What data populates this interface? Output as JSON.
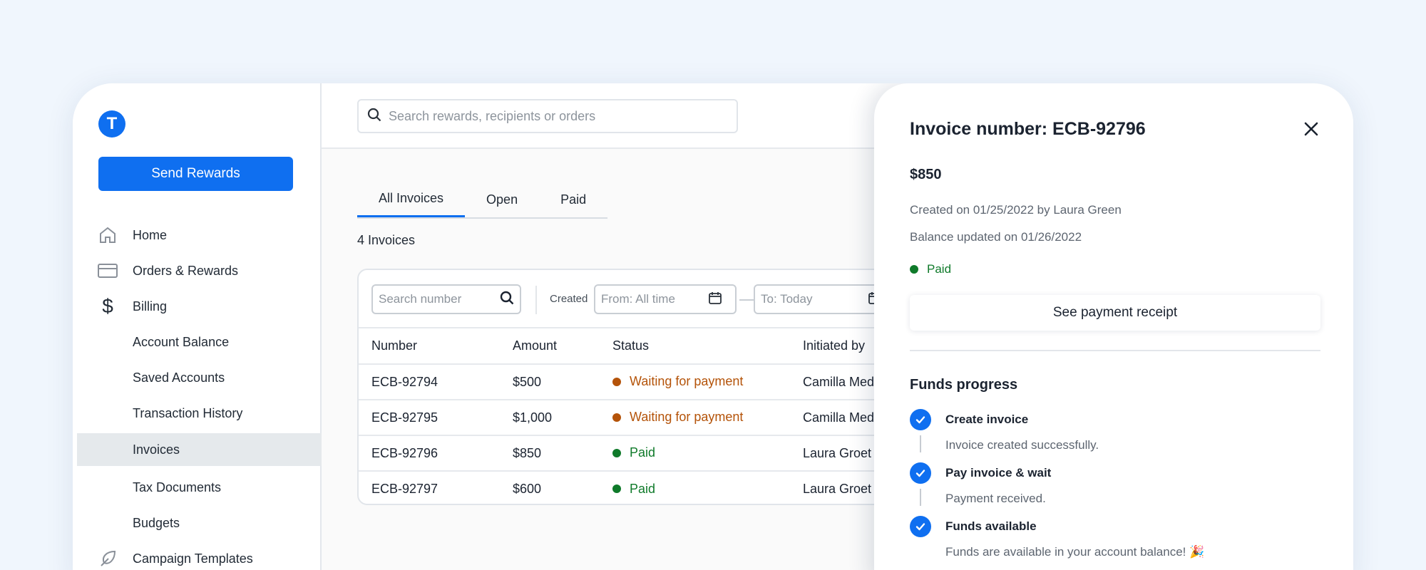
{
  "brand": {
    "logo_letter": "T",
    "accent": "#0f6ff0"
  },
  "sidebar": {
    "send_label": "Send Rewards",
    "items": [
      {
        "label": "Home",
        "icon": "home-icon"
      },
      {
        "label": "Orders & Rewards",
        "icon": "card-icon"
      },
      {
        "label": "Billing",
        "icon": "dollar-icon"
      },
      {
        "label": "Account Balance"
      },
      {
        "label": "Saved Accounts"
      },
      {
        "label": "Transaction History"
      },
      {
        "label": "Invoices"
      },
      {
        "label": "Tax Documents"
      },
      {
        "label": "Budgets"
      },
      {
        "label": "Campaign Templates",
        "icon": "feather-icon"
      }
    ],
    "active": "Invoices"
  },
  "topbar": {
    "search_placeholder": "Search rewards, recipients or orders"
  },
  "tabs": [
    {
      "label": "All Invoices",
      "active": true
    },
    {
      "label": "Open"
    },
    {
      "label": "Paid"
    }
  ],
  "invoice_count": "4 Invoices",
  "filters": {
    "search_placeholder": "Search number",
    "created_label": "Created",
    "from_placeholder": "From: All time",
    "to_placeholder": "To: Today"
  },
  "table": {
    "headers": [
      "Number",
      "Amount",
      "Status",
      "Initiated by"
    ],
    "rows": [
      {
        "number": "ECB-92794",
        "amount": "$500",
        "status": "Waiting for payment",
        "status_color": "#b45309",
        "initiated": "Camilla Med"
      },
      {
        "number": "ECB-92795",
        "amount": "$1,000",
        "status": "Waiting for payment",
        "status_color": "#b45309",
        "initiated": "Camilla Med"
      },
      {
        "number": "ECB-92796",
        "amount": "$850",
        "status": "Paid",
        "status_color": "#0f7a2a",
        "initiated": "Laura Groet"
      },
      {
        "number": "ECB-92797",
        "amount": "$600",
        "status": "Paid",
        "status_color": "#0f7a2a",
        "initiated": "Laura Groet"
      }
    ]
  },
  "panel": {
    "title": "Invoice number: ECB-92796",
    "amount": "$850",
    "created": "Created on 01/25/2022 by Laura Green",
    "balance_updated": "Balance updated on 01/26/2022",
    "status": "Paid",
    "status_color": "#0f7a2a",
    "receipt_label": "See payment receipt",
    "funds_title": "Funds progress",
    "steps": [
      {
        "title": "Create invoice",
        "desc": "Invoice created successfully."
      },
      {
        "title": "Pay invoice & wait",
        "desc": "Payment received."
      },
      {
        "title": "Funds available",
        "desc": "Funds are available in your account balance! 🎉"
      }
    ]
  }
}
